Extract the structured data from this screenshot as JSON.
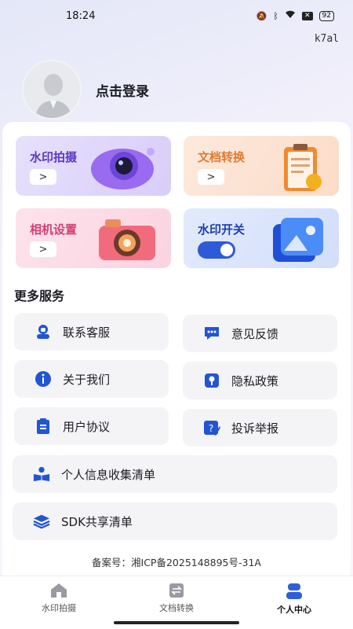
{
  "status": {
    "time": "18:24",
    "battery": "92",
    "x_badge": "✕"
  },
  "watermark_tag": "k7al",
  "profile": {
    "login_label": "点击登录"
  },
  "cards": [
    {
      "title": "水印拍摄",
      "arrow": ">"
    },
    {
      "title": "文档转换",
      "arrow": ">"
    },
    {
      "title": "相机设置",
      "arrow": ">"
    },
    {
      "title": "水印开关",
      "toggle_on": true
    }
  ],
  "more_services": {
    "title": "更多服务",
    "items": [
      {
        "label": "联系客服",
        "icon": "headset-icon"
      },
      {
        "label": "意见反馈",
        "icon": "chat-bubble-icon"
      },
      {
        "label": "关于我们",
        "icon": "info-icon"
      },
      {
        "label": "隐私政策",
        "icon": "key-lock-icon"
      },
      {
        "label": "用户协议",
        "icon": "clipboard-icon"
      },
      {
        "label": "投诉举报",
        "icon": "edit-question-icon"
      },
      {
        "label": "个人信息收集清单",
        "icon": "reading-person-icon"
      },
      {
        "label": "SDK共享清单",
        "icon": "layers-icon"
      }
    ]
  },
  "record_label": "备案号：湘ICP备2025148895号-31A",
  "tabs": [
    {
      "label": "水印拍摄",
      "icon": "home-icon",
      "active": false
    },
    {
      "label": "文档转换",
      "icon": "convert-icon",
      "active": false
    },
    {
      "label": "个人中心",
      "icon": "person-icon",
      "active": true
    }
  ],
  "colors": {
    "accent": "#2f5fd8",
    "icon_blue": "#2256d1"
  }
}
